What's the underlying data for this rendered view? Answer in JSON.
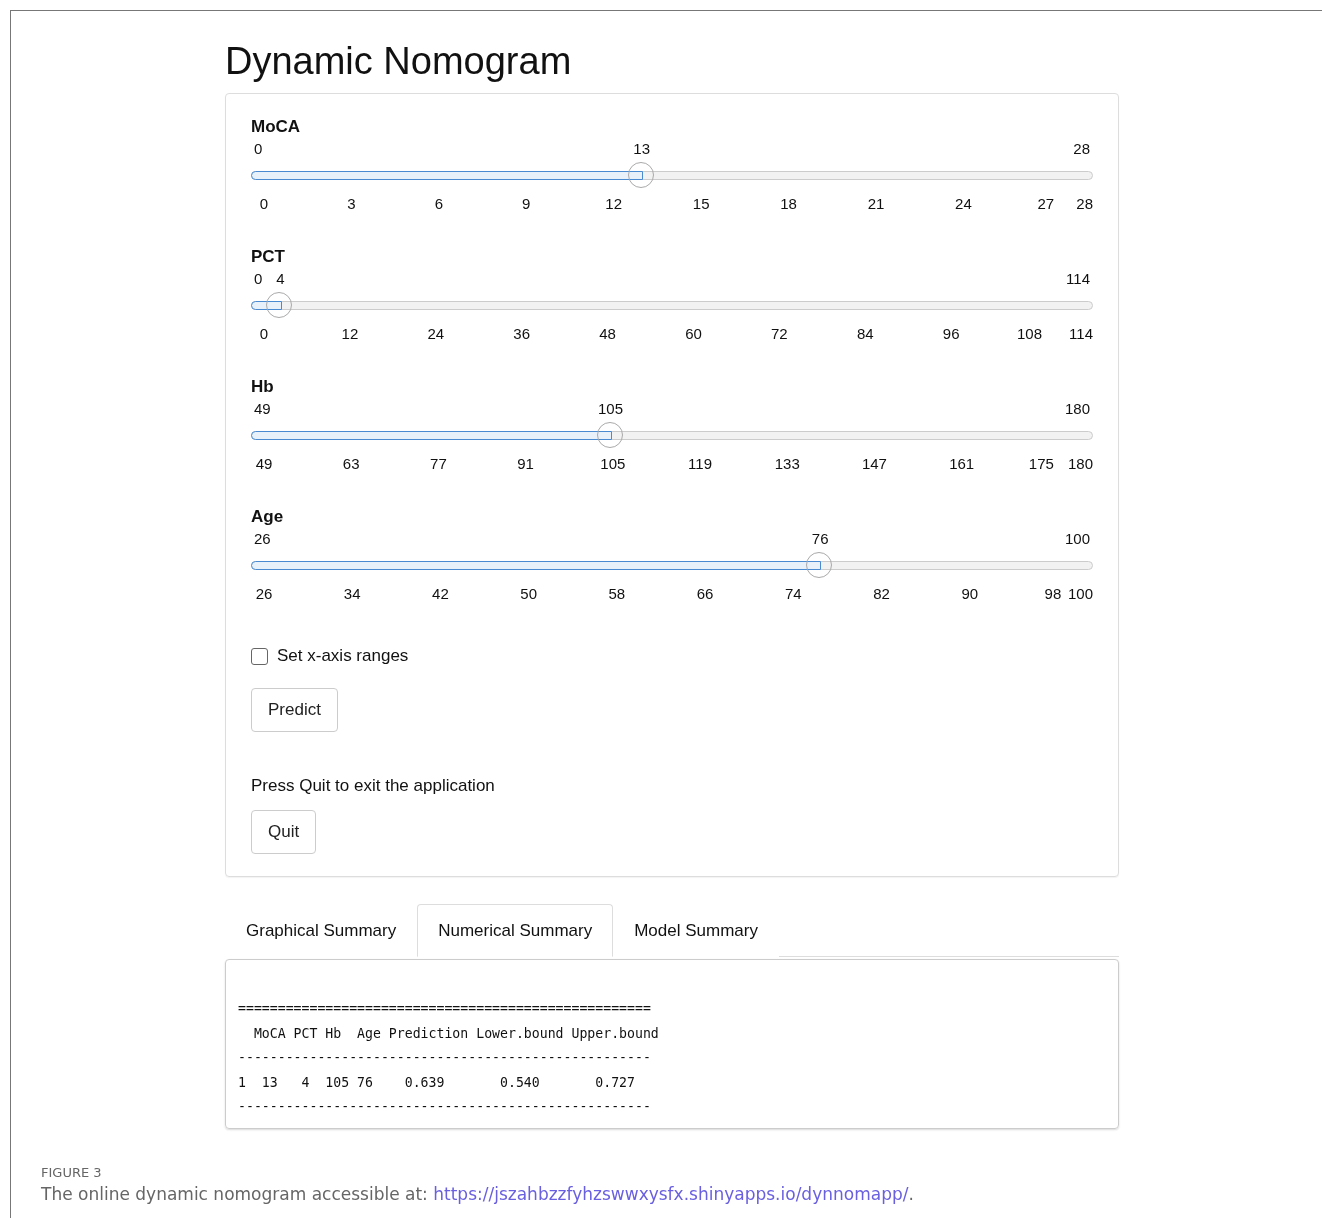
{
  "title": "Dynamic Nomogram",
  "sliders": [
    {
      "label": "MoCA",
      "min": "0",
      "value": "13",
      "max": "28",
      "level": 0.464,
      "ticks": [
        "0",
        "3",
        "6",
        "9",
        "12",
        "15",
        "18",
        "21",
        "24",
        "27",
        "28"
      ]
    },
    {
      "label": "PCT",
      "min": "0",
      "value": "4",
      "max": "114",
      "level": 0.035,
      "ticks": [
        "0",
        "12",
        "24",
        "36",
        "48",
        "60",
        "72",
        "84",
        "96",
        "108",
        "114"
      ]
    },
    {
      "label": "Hb",
      "min": "49",
      "value": "105",
      "max": "180",
      "level": 0.427,
      "ticks": [
        "49",
        "63",
        "77",
        "91",
        "105",
        "119",
        "133",
        "147",
        "161",
        "175",
        "180"
      ]
    },
    {
      "label": "Age",
      "min": "26",
      "value": "76",
      "max": "100",
      "level": 0.676,
      "ticks": [
        "26",
        "34",
        "42",
        "50",
        "58",
        "66",
        "74",
        "82",
        "90",
        "98",
        "100"
      ]
    }
  ],
  "checkbox": {
    "label": "Set x-axis ranges",
    "checked": false
  },
  "predict_button": "Predict",
  "quit_text": "Press Quit to exit the application",
  "quit_button": "Quit",
  "tabs": [
    {
      "label": "Graphical Summary",
      "selected": false
    },
    {
      "label": "Numerical Summary",
      "selected": true
    },
    {
      "label": "Model Summary",
      "selected": false
    }
  ],
  "output_lines": [
    "====================================================",
    "  MoCA PCT Hb  Age Prediction Lower.bound Upper.bound",
    "----------------------------------------------------",
    "1  13   4  105 76    0.639       0.540       0.727",
    "----------------------------------------------------"
  ],
  "caption": {
    "label": "FIGURE 3",
    "text": "The online dynamic nomogram accessible at: ",
    "link": "https://jszahbzzfyhzswwxysfx.shinyapps.io/dynnomapp/",
    "end": "."
  }
}
